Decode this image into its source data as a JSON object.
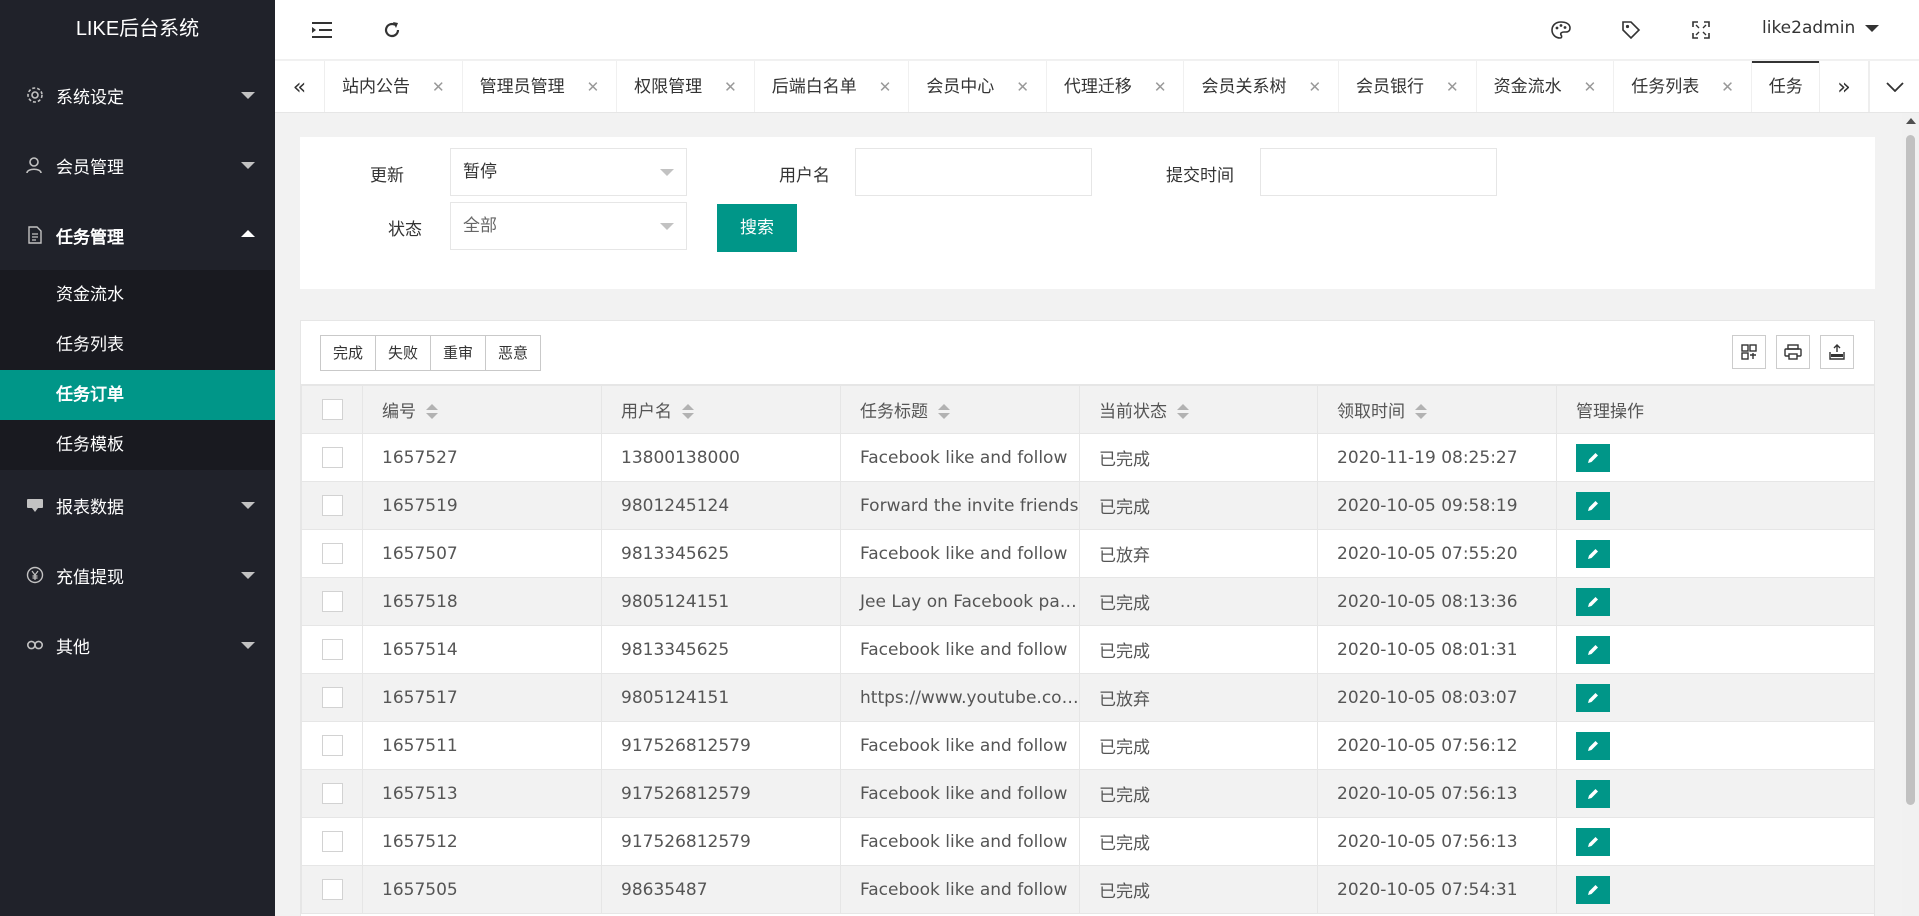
{
  "app": {
    "title": "LIKE后台系统"
  },
  "sidebar": {
    "menus": [
      {
        "label": "系统设定",
        "icon": "gear-icon"
      },
      {
        "label": "会员管理",
        "icon": "user-icon"
      },
      {
        "label": "任务管理",
        "icon": "document-icon",
        "open": true,
        "children": [
          "资金流水",
          "任务列表",
          "任务订单",
          "任务模板"
        ],
        "active_child": "任务订单"
      },
      {
        "label": "报表数据",
        "icon": "chat-icon"
      },
      {
        "label": "充值提现",
        "icon": "yen-icon"
      },
      {
        "label": "其他",
        "icon": "link-icon"
      }
    ]
  },
  "header": {
    "user": "like2admin"
  },
  "tabs": [
    "站内公告",
    "管理员管理",
    "权限管理",
    "后端白名单",
    "会员中心",
    "代理迁移",
    "会员关系树",
    "会员银行",
    "资金流水",
    "任务列表",
    "任务"
  ],
  "search": {
    "update_label": "更新",
    "update_value": "暂停",
    "username_label": "用户名",
    "username_value": "",
    "time_label": "提交时间",
    "time_value": "",
    "status_label": "状态",
    "status_value": "全部",
    "search_button": "搜索"
  },
  "toolbar": {
    "buttons": [
      "完成",
      "失败",
      "重审",
      "恶意"
    ]
  },
  "table": {
    "columns": [
      "编号",
      "用户名",
      "任务标题",
      "当前状态",
      "领取时间",
      "管理操作"
    ],
    "rows": [
      [
        "1657527",
        "13800138000",
        "Facebook like and follow",
        "已完成",
        "2020-11-19 08:25:27"
      ],
      [
        "1657519",
        "9801245124",
        "Forward the invite friends",
        "已完成",
        "2020-10-05 09:58:19"
      ],
      [
        "1657507",
        "9813345625",
        "Facebook like and follow",
        "已放弃",
        "2020-10-05 07:55:20"
      ],
      [
        "1657518",
        "9805124151",
        "Jee Lay on Facebook page",
        "已完成",
        "2020-10-05 08:13:36"
      ],
      [
        "1657514",
        "9813345625",
        "Facebook like and follow",
        "已完成",
        "2020-10-05 08:01:31"
      ],
      [
        "1657517",
        "9805124151",
        "https://www.youtube.com/watch",
        "已放弃",
        "2020-10-05 08:03:07"
      ],
      [
        "1657511",
        "917526812579",
        "Facebook like and follow",
        "已完成",
        "2020-10-05 07:56:12"
      ],
      [
        "1657513",
        "917526812579",
        "Facebook like and follow",
        "已完成",
        "2020-10-05 07:56:13"
      ],
      [
        "1657512",
        "917526812579",
        "Facebook like and follow",
        "已完成",
        "2020-10-05 07:56:13"
      ],
      [
        "1657505",
        "98635487",
        "Facebook like and follow",
        "已完成",
        "2020-10-05 07:54:31"
      ]
    ]
  },
  "colors": {
    "sidebar_bg": "#20222a",
    "accent": "#009688"
  }
}
